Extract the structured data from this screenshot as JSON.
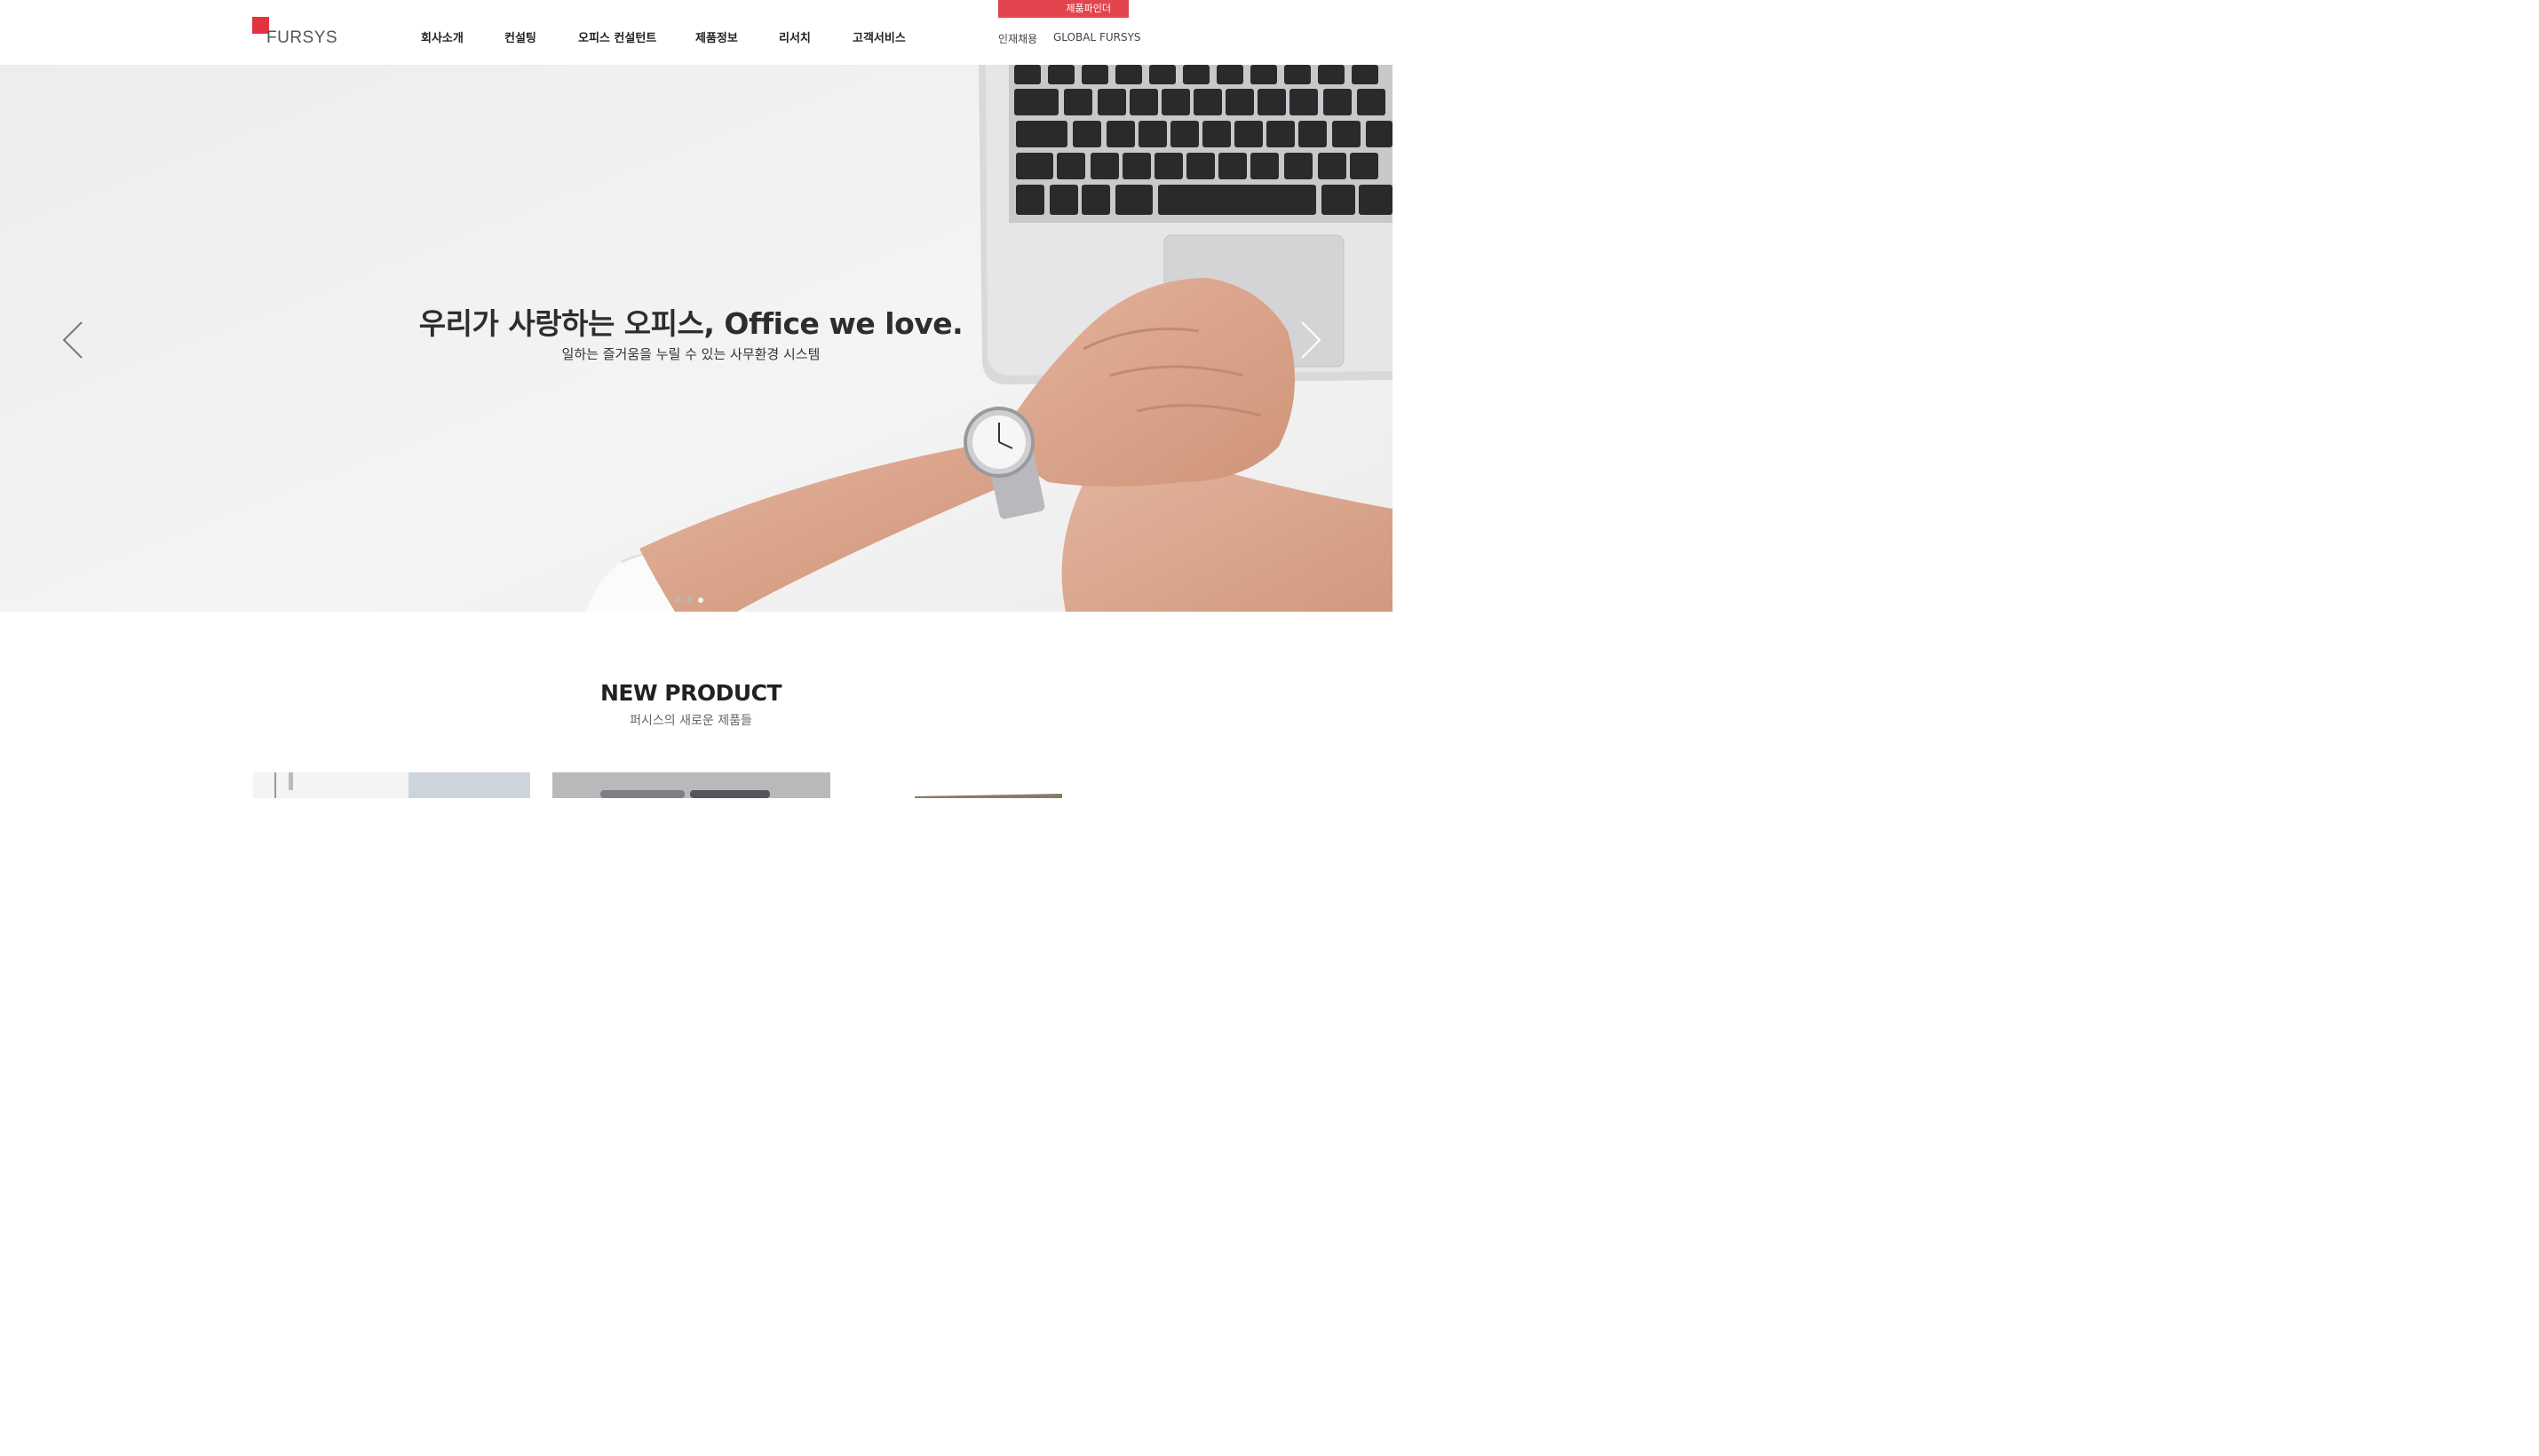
{
  "brand": {
    "logo_text": "FURSYS",
    "accent_color": "#e3333f"
  },
  "nav": {
    "items": [
      {
        "label": "회사소개"
      },
      {
        "label": "컨설팅"
      },
      {
        "label": "오피스 컨설턴트"
      },
      {
        "label": "제품정보"
      },
      {
        "label": "리서치"
      },
      {
        "label": "고객서비스"
      }
    ]
  },
  "utility": {
    "finder_label": "제품파인더",
    "finder_color": "#e3454f",
    "recruit_label": "인재채용",
    "global_label": "GLOBAL FURSYS"
  },
  "hero": {
    "title": "우리가 사랑하는 오피스, Office we love.",
    "subtitle": "일하는 즐거움을 누릴 수 있는 사무환경 시스템",
    "prev_icon": "chevron-left-icon",
    "next_icon": "chevron-right-icon",
    "slides_count": 3,
    "active_slide": 3
  },
  "new_product": {
    "title": "NEW PRODUCT",
    "subtitle": "퍼시스의 새로운 제품들"
  }
}
